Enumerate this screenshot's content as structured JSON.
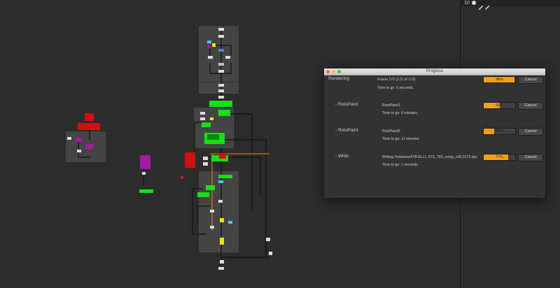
{
  "topbar": {
    "frame_number": "10"
  },
  "dialog": {
    "title": "Progress",
    "cancel_label": "Cancel",
    "rows": [
      {
        "name": "Rendering",
        "line1": "Frame 172 (172 of 173)",
        "line2": "Time to go: 6 seconds.",
        "percent_label": "98%",
        "progress": 0.98
      },
      {
        "name": "- RotoPaint",
        "line1": "RotoPaint1",
        "line2": "Time to go: 6 minutes.",
        "percent_label": "50%",
        "progress": 0.5
      },
      {
        "name": "- RotoPaint",
        "line1": "RotoPaint2",
        "line2": "Time to go: 11 minutes.",
        "percent_label": "33%",
        "progress": 0.33
      },
      {
        "name": "- Write",
        "line1": "Writing /Volumes/4TB ELLI...072_760_comp_v09.0172.dpx",
        "line2": "Time to go: 1 seconds.",
        "percent_label": "77%",
        "progress": 0.77
      }
    ]
  },
  "colors": {
    "background": "#2c2c2c",
    "backdrop": "#444444",
    "progress_fill": "#f0a01e",
    "node_green": "#16e016",
    "node_red": "#d01010",
    "node_purple": "#a21aa2"
  }
}
